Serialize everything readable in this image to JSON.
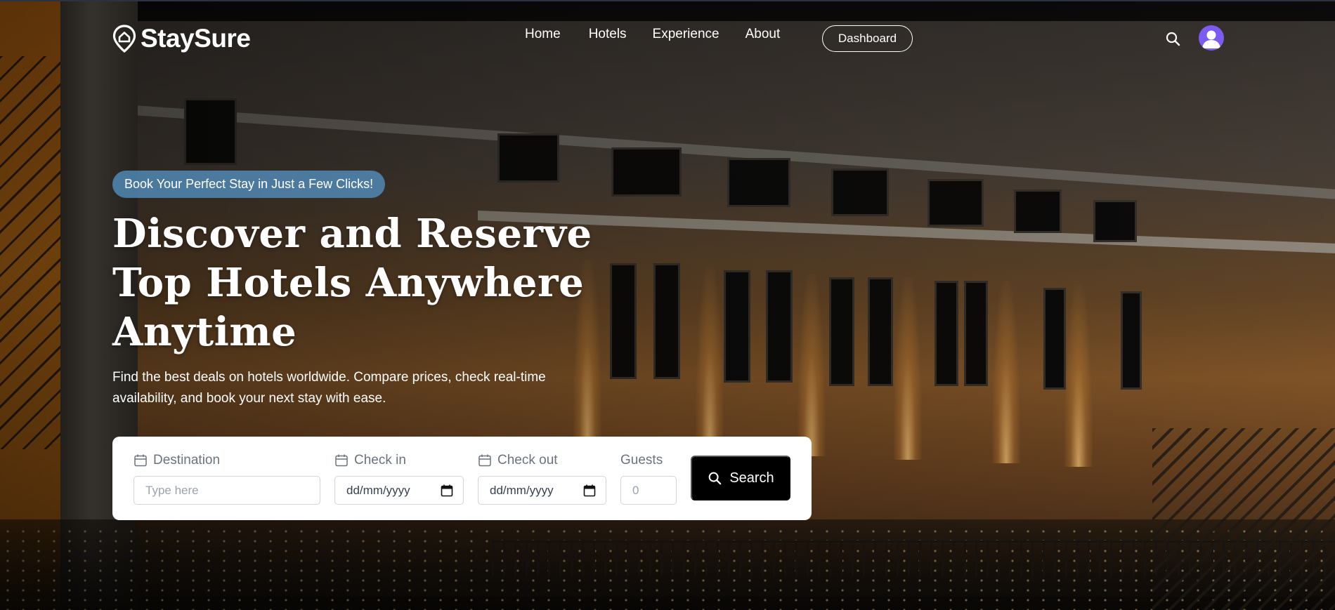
{
  "brand": {
    "name": "StaySure"
  },
  "nav": {
    "links": [
      "Home",
      "Hotels",
      "Experience",
      "About"
    ],
    "dashboard_label": "Dashboard"
  },
  "hero": {
    "badge": "Book Your Perfect Stay in Just a Few Clicks!",
    "title_lines": [
      "Discover and Reserve",
      "Top Hotels Anywhere",
      "Anytime"
    ],
    "subtitle": "Find the best deals on hotels worldwide. Compare prices, check real-time availability, and book your next stay with ease."
  },
  "search": {
    "destination": {
      "label": "Destination",
      "placeholder": "Type here"
    },
    "check_in": {
      "label": "Check in",
      "value": "dd/mm/yyyy"
    },
    "check_out": {
      "label": "Check out",
      "value": "dd/mm/yyyy"
    },
    "guests": {
      "label": "Guests",
      "placeholder": "0"
    },
    "button_label": "Search"
  },
  "icons": {
    "logo": "location-pin-house-icon",
    "nav_search": "search-icon",
    "avatar": "user-avatar-icon",
    "calendar": "calendar-icon",
    "date_picker": "date-picker-icon",
    "button_search": "search-icon"
  },
  "colors": {
    "badge_bg": "#5696c8",
    "avatar_bg": "#7c5cf0",
    "search_button_bg": "#000000",
    "card_bg": "#ffffff"
  }
}
